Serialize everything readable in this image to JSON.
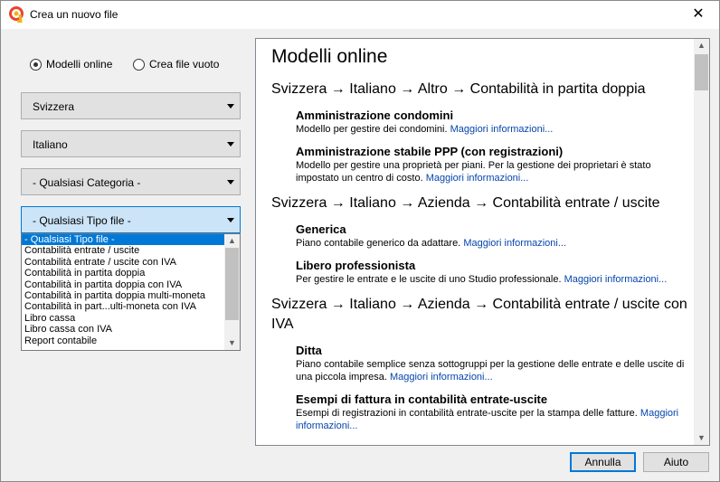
{
  "window": {
    "title": "Crea un nuovo file",
    "close_glyph": "✕"
  },
  "mode": {
    "online_label": "Modelli online",
    "empty_label": "Crea file vuoto",
    "selected": "online"
  },
  "filters": {
    "country": "Svizzera",
    "language": "Italiano",
    "category": "- Qualsiasi Categoria -",
    "filetype": "- Qualsiasi Tipo file -"
  },
  "filetype_options": [
    "- Qualsiasi Tipo file -",
    "Contabilità entrate / uscite",
    "Contabilità entrate / uscite con IVA",
    "Contabilità in partita doppia",
    "Contabilità in partita doppia con IVA",
    "Contabilità in partita doppia multi-moneta",
    "Contabilità in part...ulti-moneta con IVA",
    "Libro cassa",
    "Libro cassa con IVA",
    "Report contabile"
  ],
  "panel": {
    "heading": "Modelli online",
    "more_info": "Maggiori informazioni...",
    "groups": [
      {
        "title": "Svizzera → Italiano → Altro → Contabilità in partita doppia",
        "items": [
          {
            "title": "Amministrazione condomini",
            "desc": "Modello per gestire dei condomini."
          },
          {
            "title": "Amministrazione stabile PPP (con registrazioni)",
            "desc": "Modello per gestire una proprietà per piani. Per la gestione dei proprietari è stato impostato un centro di costo."
          }
        ]
      },
      {
        "title": "Svizzera → Italiano → Azienda → Contabilità entrate / uscite",
        "items": [
          {
            "title": "Generica",
            "desc": "Piano contabile generico da adattare."
          },
          {
            "title": "Libero professionista",
            "desc": "Per gestire le entrate e le uscite di uno Studio professionale."
          }
        ]
      },
      {
        "title": "Svizzera → Italiano → Azienda → Contabilità entrate / uscite con IVA",
        "items": [
          {
            "title": "Ditta",
            "desc": "Piano contabile semplice senza sottogruppi per la gestione delle entrate e delle uscite di una piccola impresa."
          },
          {
            "title": "Esempi di fattura in contabilità entrate-uscite",
            "desc": "Esempi di registrazioni in contabilità entrate-uscite per la stampa delle fatture."
          }
        ]
      }
    ]
  },
  "buttons": {
    "cancel": "Annulla",
    "help": "Aiuto"
  },
  "colors": {
    "accent": "#0078d7",
    "link": "#0645ad",
    "app_icon": "#e8452c"
  },
  "icons": {
    "app": "banana-app-icon",
    "close": "close-icon",
    "dropdown": "chevron-down-icon"
  }
}
